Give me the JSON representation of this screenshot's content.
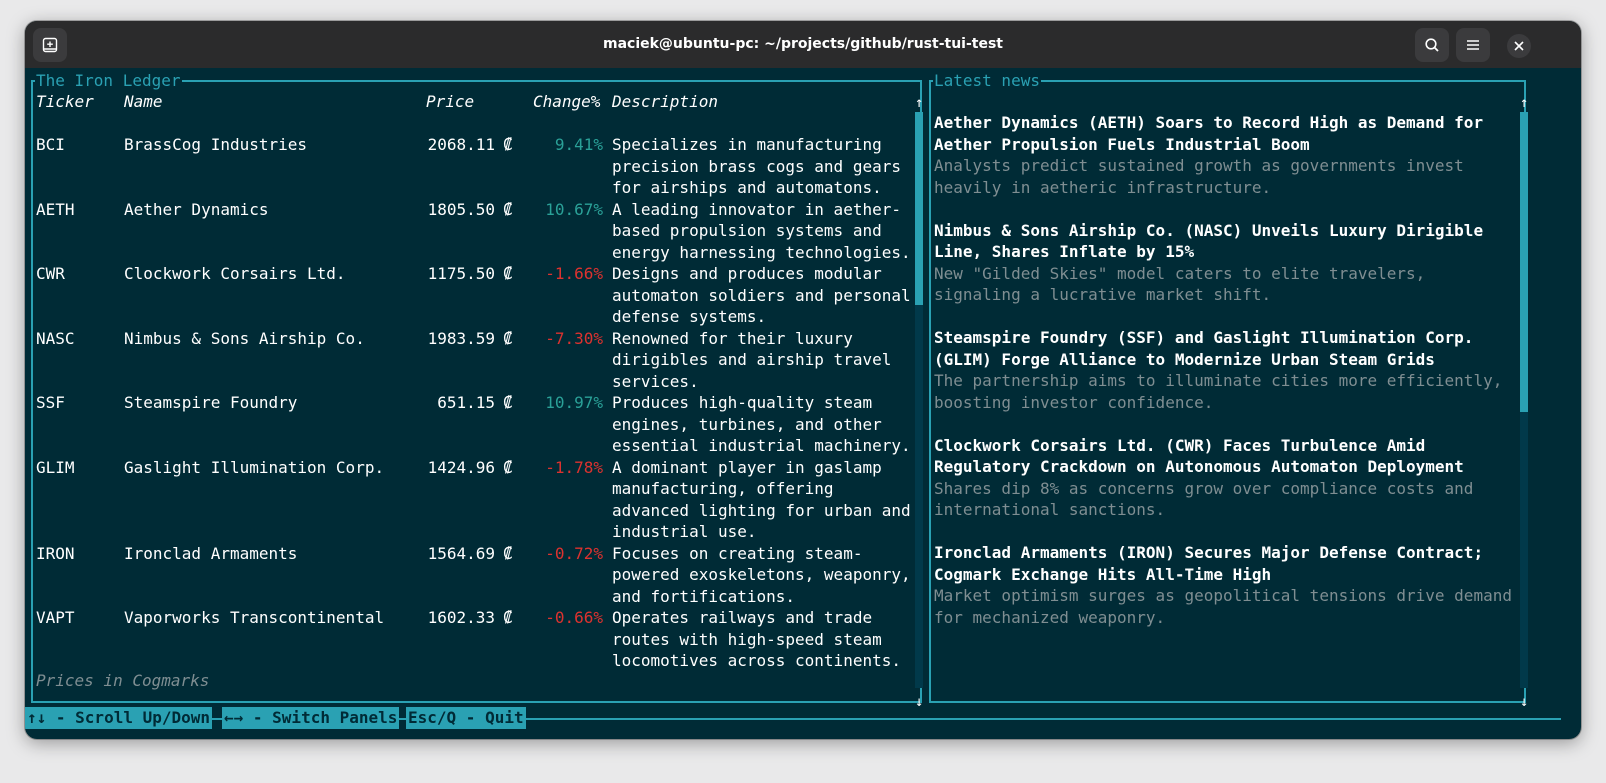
{
  "window": {
    "title": "maciek@ubuntu-pc: ~/projects/github/rust-tui-test"
  },
  "ledger": {
    "title": "The Iron Ledger",
    "headers": {
      "ticker": "Ticker",
      "name": "Name",
      "price": "Price",
      "change": "Change%",
      "description": "Description"
    },
    "currency_symbol": "₡",
    "rows": [
      {
        "ticker": "BCI",
        "name": "BrassCog Industries",
        "price": "2068.11",
        "change": "9.41%",
        "direction": "up",
        "description": [
          "Specializes in manufacturing",
          "precision brass cogs and gears",
          "for airships and automatons."
        ]
      },
      {
        "ticker": "AETH",
        "name": "Aether Dynamics",
        "price": "1805.50",
        "change": "10.67%",
        "direction": "up",
        "description": [
          "A leading innovator in aether-",
          "based propulsion systems and",
          "energy harnessing technologies."
        ]
      },
      {
        "ticker": "CWR",
        "name": "Clockwork Corsairs Ltd.",
        "price": "1175.50",
        "change": "-1.66%",
        "direction": "down",
        "description": [
          "Designs and produces modular",
          "automaton soldiers and personal",
          "defense systems."
        ]
      },
      {
        "ticker": "NASC",
        "name": "Nimbus & Sons Airship Co.",
        "price": "1983.59",
        "change": "-7.30%",
        "direction": "down",
        "description": [
          "Renowned for their luxury",
          "dirigibles and airship travel",
          "services."
        ]
      },
      {
        "ticker": "SSF",
        "name": "Steamspire Foundry",
        "price": "651.15",
        "change": "10.97%",
        "direction": "up",
        "description": [
          "Produces high-quality steam",
          "engines, turbines, and other",
          "essential industrial machinery."
        ]
      },
      {
        "ticker": "GLIM",
        "name": "Gaslight Illumination Corp.",
        "price": "1424.96",
        "change": "-1.78%",
        "direction": "down",
        "description": [
          "A dominant player in gaslamp",
          "manufacturing, offering",
          "advanced lighting for urban and",
          "industrial use."
        ]
      },
      {
        "ticker": "IRON",
        "name": "Ironclad Armaments",
        "price": "1564.69",
        "change": "-0.72%",
        "direction": "down",
        "description": [
          "Focuses on creating steam-",
          "powered exoskeletons, weaponry,",
          "and fortifications."
        ]
      },
      {
        "ticker": "VAPT",
        "name": "Vaporworks Transcontinental",
        "price": "1602.33",
        "change": "-0.66%",
        "direction": "down",
        "description": [
          "Operates railways and trade",
          "routes with high-speed steam",
          "locomotives across continents."
        ]
      }
    ],
    "footnote": "Prices in Cogmarks",
    "scroll_up_arrow": "↑",
    "scroll_down_arrow": "↓"
  },
  "news": {
    "title": "Latest news",
    "items": [
      {
        "headline": [
          "Aether Dynamics (AETH) Soars to Record High as Demand for",
          "Aether Propulsion Fuels Industrial Boom"
        ],
        "summary": [
          "Analysts predict sustained growth as governments invest",
          "heavily in aetheric infrastructure."
        ]
      },
      {
        "headline": [
          "Nimbus & Sons Airship Co. (NASC) Unveils Luxury Dirigible",
          "Line, Shares Inflate by 15%"
        ],
        "summary": [
          "New \"Gilded Skies\" model caters to elite travelers,",
          "signaling a lucrative market shift."
        ]
      },
      {
        "headline": [
          "Steamspire Foundry (SSF) and Gaslight Illumination Corp.",
          "(GLIM) Forge Alliance to Modernize Urban Steam Grids"
        ],
        "summary": [
          "The partnership aims to illuminate cities more efficiently,",
          "boosting investor confidence."
        ]
      },
      {
        "headline": [
          "Clockwork Corsairs Ltd. (CWR) Faces Turbulence Amid",
          "Regulatory Crackdown on Autonomous Automaton Deployment"
        ],
        "summary": [
          "Shares dip 8% as concerns grow over compliance costs and",
          "international sanctions."
        ]
      },
      {
        "headline": [
          "Ironclad Armaments (IRON) Secures Major Defense Contract;",
          "Cogmark Exchange Hits All-Time High"
        ],
        "summary": [
          "Market optimism surges as geopolitical tensions drive demand",
          "for mechanized weaponry."
        ]
      }
    ]
  },
  "footer": {
    "keys": [
      {
        "label": "↑↓ - Scroll Up/Down"
      },
      {
        "label": "←→ - Switch Panels"
      },
      {
        "label": "Esc/Q - Quit"
      }
    ]
  },
  "colors": {
    "background": "#002b36",
    "border": "#2aa1b3",
    "positive": "#2aa198",
    "negative": "#dc322f",
    "muted": "#7f8e92"
  }
}
